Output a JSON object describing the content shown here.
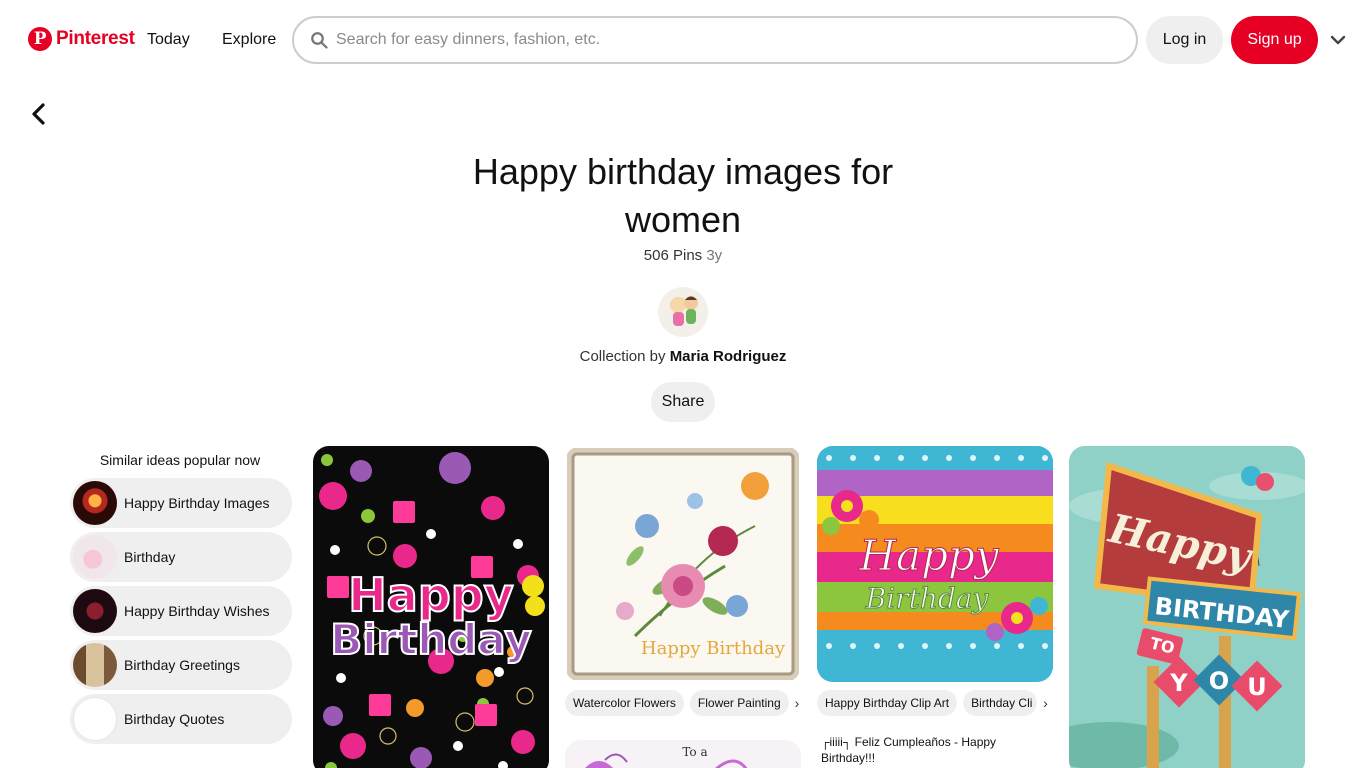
{
  "header": {
    "brand": "Pinterest",
    "nav": {
      "today": "Today",
      "explore": "Explore"
    },
    "search_placeholder": "Search for easy dinners, fashion, etc.",
    "login": "Log in",
    "signup": "Sign up"
  },
  "board": {
    "title": "Happy birthday images for women",
    "pin_count": "506 Pins",
    "age": "3y",
    "collection_prefix": "Collection by",
    "owner": "Maria Rodriguez",
    "share": "Share"
  },
  "similar": {
    "title": "Similar ideas popular now",
    "items": [
      {
        "label": "Happy Birthday Images"
      },
      {
        "label": "Birthday"
      },
      {
        "label": "Happy Birthday Wishes"
      },
      {
        "label": "Birthday Greetings"
      },
      {
        "label": "Birthday Quotes"
      }
    ]
  },
  "pins": {
    "pin1": {
      "text1": "Happy",
      "text2": "Birthday"
    },
    "pin2": {
      "text": "Happy Birthday",
      "chips": [
        "Watercolor Flowers",
        "Flower Painting"
      ]
    },
    "pin3": {
      "text1": "Happy",
      "text2": "Birthday",
      "chips": [
        "Happy Birthday Clip Art",
        "Birthday Cli"
      ],
      "caption": "┌iiiii┐ Feliz Cumpleaños - Happy Birthday!!!"
    },
    "pin4": {
      "text1": "Happy",
      "text2": "BIRTHDAY",
      "text3": "TO",
      "text4": "Y",
      "text5": "O",
      "text6": "U"
    },
    "pin5": {
      "text1": "To a"
    }
  },
  "colors": {
    "brand_red": "#e60023",
    "chip_bg": "#efefef"
  }
}
